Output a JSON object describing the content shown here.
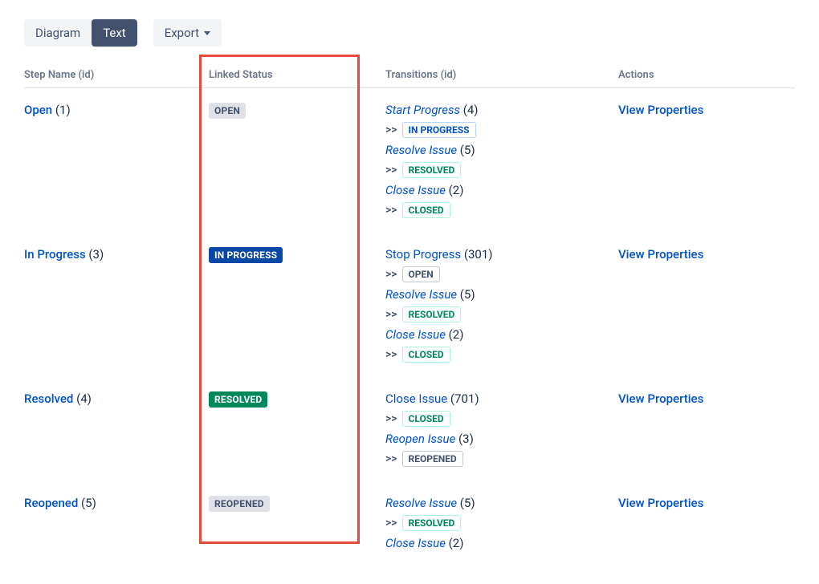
{
  "tabs": {
    "diagram": "Diagram",
    "text": "Text",
    "export": "Export"
  },
  "headers": {
    "step": "Step Name (id)",
    "linked": "Linked Status",
    "transitions": "Transitions (id)",
    "actions": "Actions"
  },
  "arrow": ">>",
  "action_label": "View Properties",
  "rows": [
    {
      "step_name": "Open",
      "step_id": "(1)",
      "step_italic": false,
      "linked_label": "OPEN",
      "linked_class": "loz-open",
      "transitions": [
        {
          "name": "Start Progress",
          "id": "(4)",
          "italic": true,
          "dest_label": "IN PROGRESS",
          "dest_class": "tloz-inprog"
        },
        {
          "name": "Resolve Issue",
          "id": "(5)",
          "italic": true,
          "dest_label": "RESOLVED",
          "dest_class": "tloz-resolved"
        },
        {
          "name": "Close Issue",
          "id": "(2)",
          "italic": true,
          "dest_label": "CLOSED",
          "dest_class": "tloz-closed"
        }
      ]
    },
    {
      "step_name": "In Progress",
      "step_id": "(3)",
      "step_italic": false,
      "linked_label": "IN PROGRESS",
      "linked_class": "loz-inprog",
      "transitions": [
        {
          "name": "Stop Progress",
          "id": "(301)",
          "italic": false,
          "dest_label": "OPEN",
          "dest_class": "tloz-open"
        },
        {
          "name": "Resolve Issue",
          "id": "(5)",
          "italic": true,
          "dest_label": "RESOLVED",
          "dest_class": "tloz-resolved"
        },
        {
          "name": "Close Issue",
          "id": "(2)",
          "italic": true,
          "dest_label": "CLOSED",
          "dest_class": "tloz-closed"
        }
      ]
    },
    {
      "step_name": "Resolved",
      "step_id": "(4)",
      "step_italic": false,
      "linked_label": "RESOLVED",
      "linked_class": "loz-resolved",
      "transitions": [
        {
          "name": "Close Issue",
          "id": "(701)",
          "italic": false,
          "dest_label": "CLOSED",
          "dest_class": "tloz-closed"
        },
        {
          "name": "Reopen Issue",
          "id": "(3)",
          "italic": true,
          "dest_label": "REOPENED",
          "dest_class": "tloz-reopened"
        }
      ]
    },
    {
      "step_name": "Reopened",
      "step_id": "(5)",
      "step_italic": false,
      "linked_label": "REOPENED",
      "linked_class": "loz-reopened",
      "transitions": [
        {
          "name": "Resolve Issue",
          "id": "(5)",
          "italic": true,
          "dest_label": "RESOLVED",
          "dest_class": "tloz-resolved"
        },
        {
          "name": "Close Issue",
          "id": "(2)",
          "italic": true,
          "dest_label": "",
          "dest_class": ""
        }
      ]
    }
  ]
}
